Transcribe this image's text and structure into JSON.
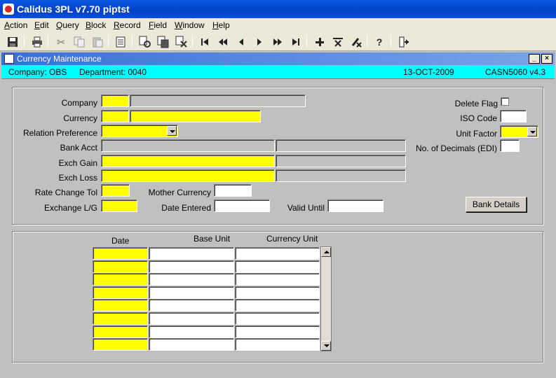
{
  "app": {
    "title": "Calidus 3PL v7.70 piptst"
  },
  "menu": [
    {
      "label": "Action",
      "underline": "A",
      "rest": "ction"
    },
    {
      "label": "Edit",
      "underline": "E",
      "rest": "dit"
    },
    {
      "label": "Query",
      "underline": "Q",
      "rest": "uery"
    },
    {
      "label": "Block",
      "underline": "B",
      "rest": "lock"
    },
    {
      "label": "Record",
      "underline": "R",
      "rest": "ecord"
    },
    {
      "label": "Field",
      "underline": "F",
      "rest": "ield"
    },
    {
      "label": "Window",
      "underline": "W",
      "rest": "indow"
    },
    {
      "label": "Help",
      "underline": "H",
      "rest": "elp"
    }
  ],
  "toolbar": {
    "icons": [
      "save-icon",
      "print-icon",
      "cut-icon",
      "copy-icon",
      "paste-icon",
      "edit-icon",
      "enter-query-icon",
      "execute-query-icon",
      "cancel-query-icon",
      "first-record-icon",
      "previous-block-icon",
      "previous-record-icon",
      "next-record-icon",
      "next-block-icon",
      "last-record-icon",
      "insert-record-icon",
      "delete-record-icon",
      "clear-record-icon",
      "help-icon",
      "exit-icon"
    ]
  },
  "window": {
    "title": "Currency Maintenance",
    "minimize": "_",
    "close": "×"
  },
  "info": {
    "company": "Company: OBS",
    "department": "Department: 0040",
    "date": "13-OCT-2009",
    "module": "CASN5060 v4.3"
  },
  "form": {
    "company_label": "Company",
    "currency_label": "Currency",
    "relation_pref_label": "Relation Preference",
    "bank_acct_label": "Bank Acct",
    "exch_gain_label": "Exch Gain",
    "exch_loss_label": "Exch Loss",
    "rate_change_tol_label": "Rate Change Tol",
    "exchange_lg_label": "Exchange L/G",
    "mother_currency_label": "Mother Currency",
    "date_entered_label": "Date Entered",
    "valid_until_label": "Valid Until",
    "delete_flag_label": "Delete Flag",
    "iso_code_label": "ISO Code",
    "unit_factor_label": "Unit Factor",
    "no_decimals_label": "No. of Decimals (EDI)",
    "bank_details_button": "Bank Details"
  },
  "grid": {
    "headers": [
      "Date",
      "Base Unit",
      "Currency Unit"
    ],
    "rows": 8
  },
  "colors": {
    "required_field": "#ffff00",
    "info_bar": "#00ffff",
    "title_bar": "#0a58e0"
  }
}
